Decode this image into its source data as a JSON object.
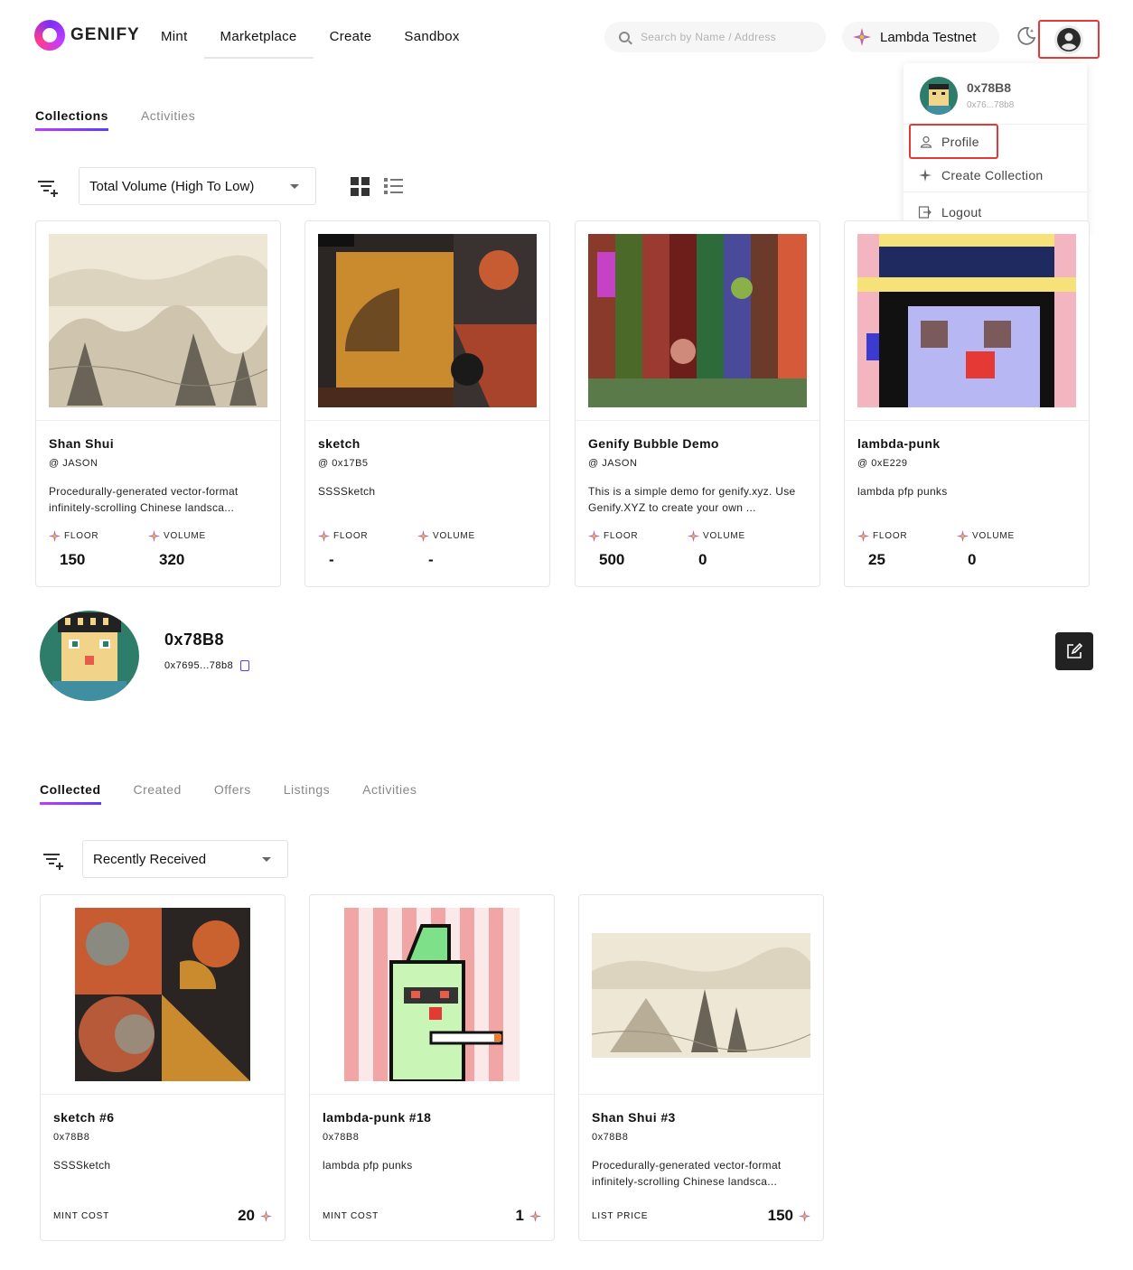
{
  "header": {
    "logo_text": "GENIFY",
    "nav": [
      "Mint",
      "Marketplace",
      "Create",
      "Sandbox"
    ],
    "search_placeholder": "Search by Name / Address",
    "network": "Lambda Testnet"
  },
  "dropdown": {
    "name": "0x78B8",
    "address": "0x76...78b8",
    "profile": "Profile",
    "create_collection": "Create Collection",
    "logout": "Logout"
  },
  "collections_tabs": [
    "Collections",
    "Activities"
  ],
  "sort_select": "Total Volume (High To Low)",
  "collections": [
    {
      "title": "Shan Shui",
      "owner": "@ JASON",
      "desc": "Procedurally-generated vector-format infinitely-scrolling Chinese landsca...",
      "floor_label": "FLOOR",
      "floor": "150",
      "volume_label": "VOLUME",
      "volume": "320"
    },
    {
      "title": "sketch",
      "owner": "@ 0x17B5",
      "desc": "SSSSketch",
      "floor_label": "FLOOR",
      "floor": "-",
      "volume_label": "VOLUME",
      "volume": "-"
    },
    {
      "title": "Genify Bubble Demo",
      "owner": "@ JASON",
      "desc": "This is a simple demo for genify.xyz. Use Genify.XYZ to create your own ...",
      "floor_label": "FLOOR",
      "floor": "500",
      "volume_label": "VOLUME",
      "volume": "0"
    },
    {
      "title": "lambda-punk",
      "owner": "@ 0xE229",
      "desc": "lambda pfp punks",
      "floor_label": "FLOOR",
      "floor": "25",
      "volume_label": "VOLUME",
      "volume": "0"
    }
  ],
  "profile": {
    "name": "0x78B8",
    "address": "0x7695...78b8"
  },
  "profile_tabs": [
    "Collected",
    "Created",
    "Offers",
    "Listings",
    "Activities"
  ],
  "received_select": "Recently Received",
  "items": [
    {
      "title": "sketch #6",
      "owner": "0x78B8",
      "desc": "SSSSketch",
      "price_label": "MINT COST",
      "price": "20"
    },
    {
      "title": "lambda-punk #18",
      "owner": "0x78B8",
      "desc": "lambda pfp punks",
      "price_label": "MINT COST",
      "price": "1"
    },
    {
      "title": "Shan Shui #3",
      "owner": "0x78B8",
      "desc": "Procedurally-generated vector-format infinitely-scrolling Chinese landsca...",
      "price_label": "LIST PRICE",
      "price": "150"
    }
  ]
}
